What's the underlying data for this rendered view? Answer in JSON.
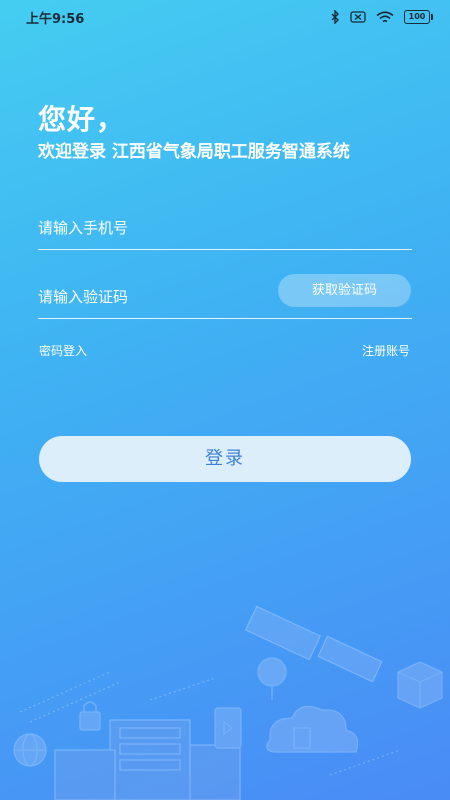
{
  "status_bar": {
    "time": "上午9:56",
    "battery_level": "100",
    "icons": [
      "bluetooth-icon",
      "no-sim-icon",
      "wifi-icon",
      "battery-icon"
    ]
  },
  "header": {
    "greeting": "您好，",
    "welcome": "欢迎登录 江西省气象局职工服务智通系统"
  },
  "form": {
    "phone_placeholder": "请输入手机号",
    "code_placeholder": "请输入验证码",
    "get_code_label": "获取验证码"
  },
  "links": {
    "password_login": "密码登入",
    "register": "注册账号"
  },
  "login_button_label": "登录",
  "colors": {
    "gradient_top": "#45cdf1",
    "gradient_bottom": "#4a8bf6",
    "login_button_bg": "#ddeefb",
    "login_button_text": "#3d7fd8"
  }
}
